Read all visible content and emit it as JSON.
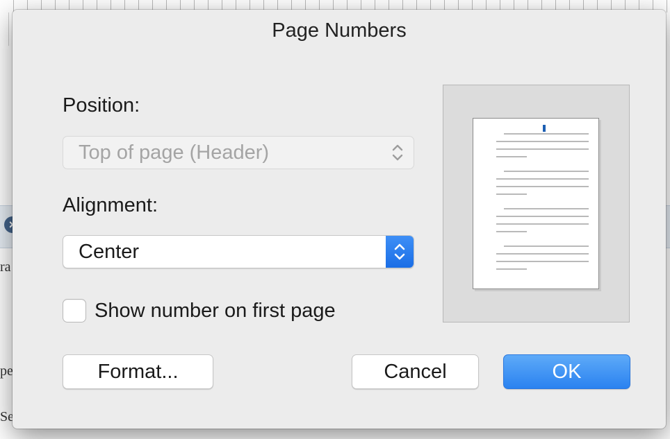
{
  "dialog": {
    "title": "Page Numbers",
    "position_label": "Position:",
    "position_value": "Top of page (Header)",
    "alignment_label": "Alignment:",
    "alignment_value": "Center",
    "checkbox_label": "Show number on first page",
    "checkbox_checked": false,
    "buttons": {
      "format": "Format...",
      "cancel": "Cancel",
      "ok": "OK"
    }
  },
  "background": {
    "fragments": [
      "ra",
      "pe",
      "Sep"
    ]
  },
  "icons": {
    "close": "close-icon",
    "updown": "chevron-updown-icon"
  },
  "colors": {
    "accent": "#2a82f0",
    "page_number_marker": "#1d5fb3"
  }
}
